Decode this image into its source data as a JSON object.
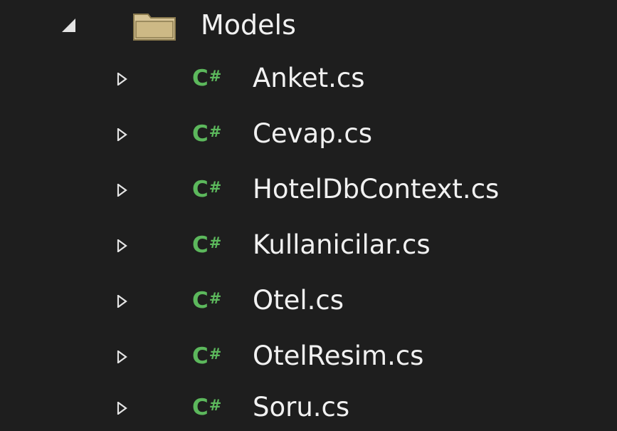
{
  "solution_explorer": {
    "folder": {
      "label": "Models",
      "expander": "collapse-triangle-icon",
      "icon": "folder-icon",
      "expanded": true
    },
    "files": [
      {
        "label": "Anket.cs",
        "icon": "csharp-file-icon",
        "expander": "expand-triangle-icon"
      },
      {
        "label": "Cevap.cs",
        "icon": "csharp-file-icon",
        "expander": "expand-triangle-icon"
      },
      {
        "label": "HotelDbContext.cs",
        "icon": "csharp-file-icon",
        "expander": "expand-triangle-icon"
      },
      {
        "label": "Kullanicilar.cs",
        "icon": "csharp-file-icon",
        "expander": "expand-triangle-icon"
      },
      {
        "label": "Otel.cs",
        "icon": "csharp-file-icon",
        "expander": "expand-triangle-icon"
      },
      {
        "label": "OtelResim.cs",
        "icon": "csharp-file-icon",
        "expander": "expand-triangle-icon"
      },
      {
        "label": "Soru.cs",
        "icon": "csharp-file-icon",
        "expander": "expand-triangle-icon"
      }
    ],
    "icon_text": {
      "c": "C",
      "hash": "#"
    }
  },
  "colors": {
    "background": "#1e1e1e",
    "text": "#f1f1f1",
    "csharp_icon": "#5cb85c",
    "folder_fill": "#d7c597"
  }
}
